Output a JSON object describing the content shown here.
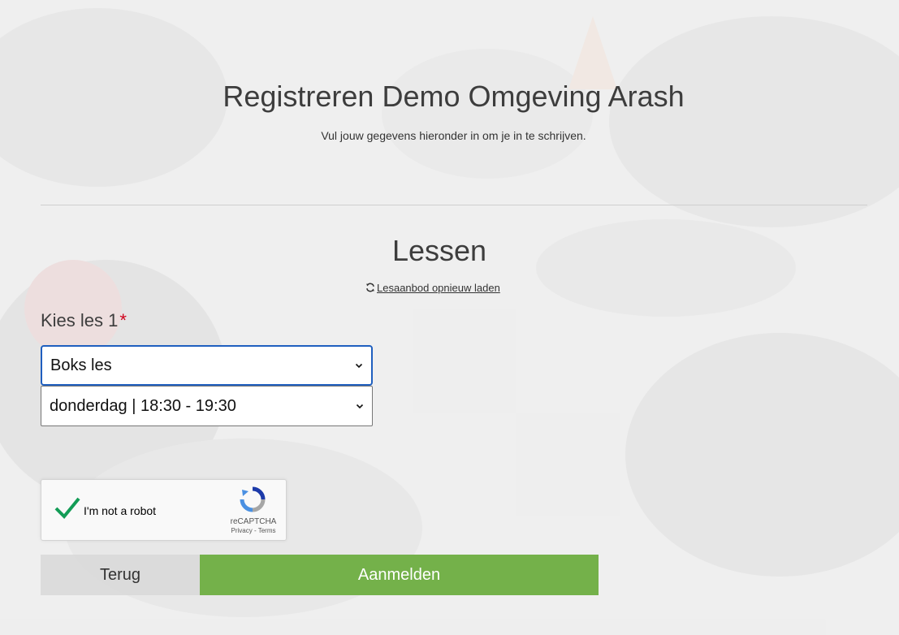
{
  "header": {
    "title": "Registreren Demo Omgeving Arash",
    "subtitle": "Vul jouw gegevens hieronder in om je in te schrijven."
  },
  "lessons": {
    "section_title": "Lessen",
    "reload_link": "Lesaanbod opnieuw laden",
    "reload_icon": "refresh-icon",
    "field_label": "Kies les 1",
    "required_mark": "*",
    "lesson_select": {
      "selected": "Boks les"
    },
    "time_select": {
      "selected": "donderdag | 18:30 - 19:30"
    }
  },
  "recaptcha": {
    "label": "I'm not a robot",
    "brand": "reCAPTCHA",
    "terms": "Privacy - Terms",
    "checked": true
  },
  "actions": {
    "back_label": "Terug",
    "submit_label": "Aanmelden"
  },
  "colors": {
    "submit": "#74b14a",
    "back": "#d7d7d7",
    "required": "#d0021b",
    "focus_border": "#1f5fbf"
  }
}
